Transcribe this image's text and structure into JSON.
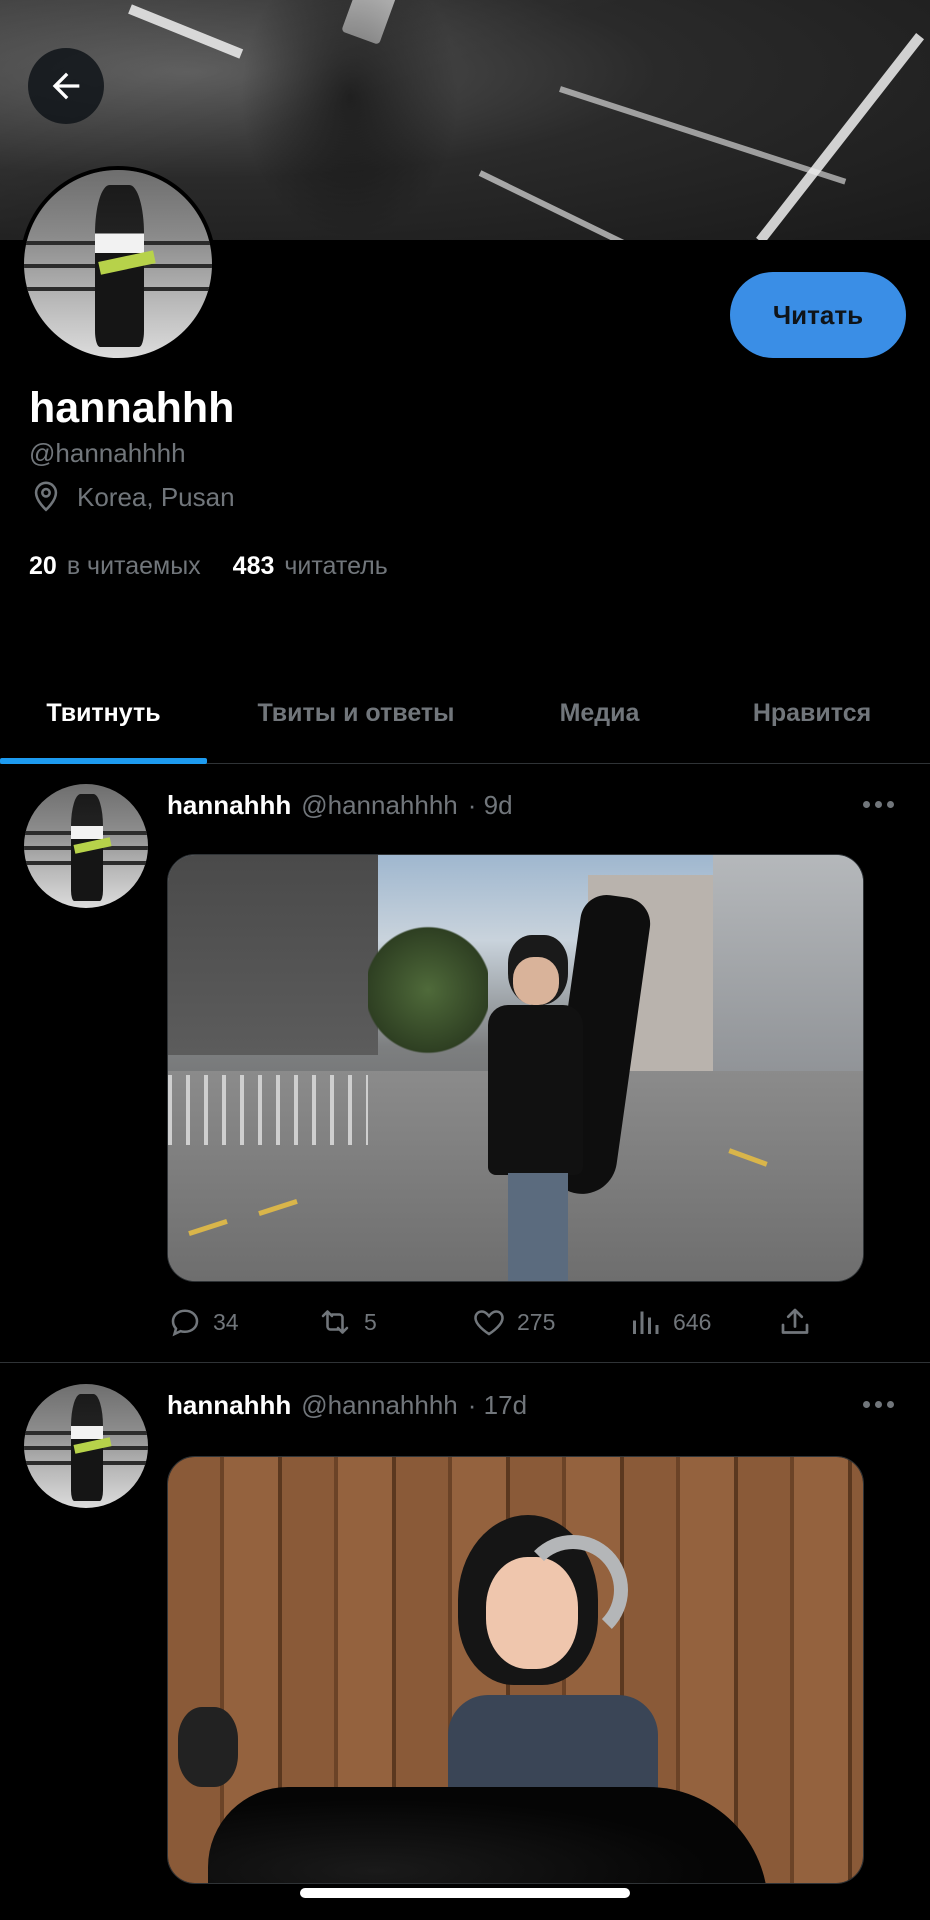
{
  "profile": {
    "back_icon": "arrow-left-icon",
    "follow_label": "Читать",
    "name": "hannahhh",
    "handle": "@hannahhhh",
    "location_icon": "location-pin-icon",
    "location": "Korea, Pusan",
    "following_count": "20",
    "following_label": "в читаемых",
    "followers_count": "483",
    "followers_label": "читатель"
  },
  "tabs": [
    {
      "label": "Твитнуть",
      "active": true
    },
    {
      "label": "Твиты и ответы",
      "active": false
    },
    {
      "label": "Медиа",
      "active": false
    },
    {
      "label": "Нравится",
      "active": false
    }
  ],
  "tweets": [
    {
      "name": "hannahhh",
      "handle": "@hannahhhh",
      "time": "· 9d",
      "replies": "34",
      "retweets": "5",
      "likes": "275",
      "views": "646"
    },
    {
      "name": "hannahhh",
      "handle": "@hannahhhh",
      "time": "· 17d"
    }
  ],
  "colors": {
    "accent": "#1d9bf0",
    "follow_button": "#3a8ee6",
    "background": "#000000",
    "muted_text": "#71767b"
  }
}
